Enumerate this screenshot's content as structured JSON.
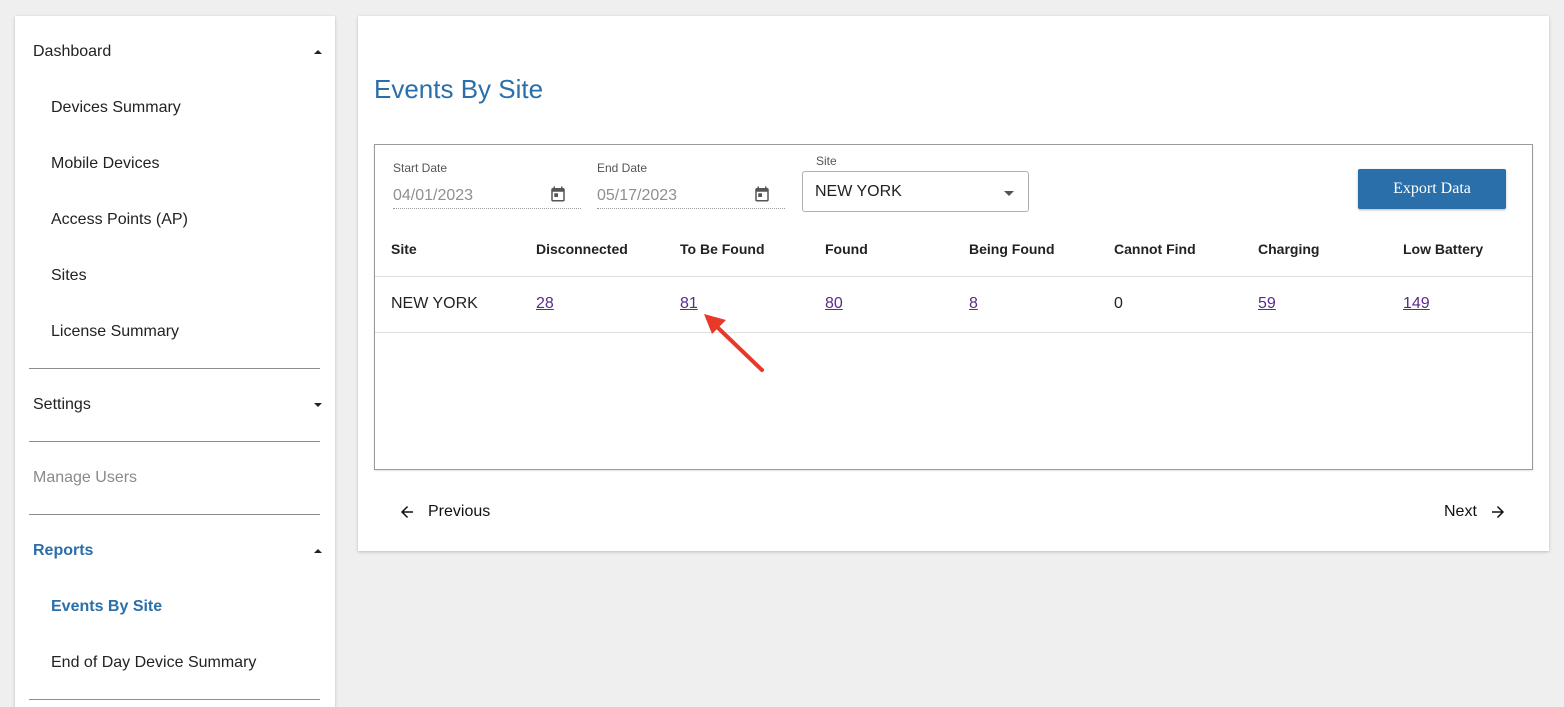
{
  "sidebar": {
    "dashboard": {
      "label": "Dashboard",
      "items": [
        "Devices Summary",
        "Mobile Devices",
        "Access Points (AP)",
        "Sites",
        "License Summary"
      ]
    },
    "settings": {
      "label": "Settings"
    },
    "manage_users": {
      "label": "Manage Users"
    },
    "reports": {
      "label": "Reports",
      "items": [
        "Events By Site",
        "End of Day Device Summary"
      ]
    }
  },
  "page": {
    "title": "Events By Site"
  },
  "filters": {
    "start_date": {
      "label": "Start Date",
      "value": "04/01/2023"
    },
    "end_date": {
      "label": "End Date",
      "value": "05/17/2023"
    },
    "site": {
      "label": "Site",
      "value": "NEW YORK"
    },
    "export_label": "Export Data"
  },
  "table": {
    "headers": [
      "Site",
      "Disconnected",
      "To Be Found",
      "Found",
      "Being Found",
      "Cannot Find",
      "Charging",
      "Low Battery"
    ],
    "rows": [
      [
        "NEW YORK",
        "28",
        "81",
        "80",
        "8",
        "0",
        "59",
        "149"
      ]
    ]
  },
  "pagination": {
    "previous": "Previous",
    "next": "Next"
  },
  "colors": {
    "accent": "#2a6faa",
    "link": "#5b2a8c",
    "annotation": "#e8382a"
  }
}
